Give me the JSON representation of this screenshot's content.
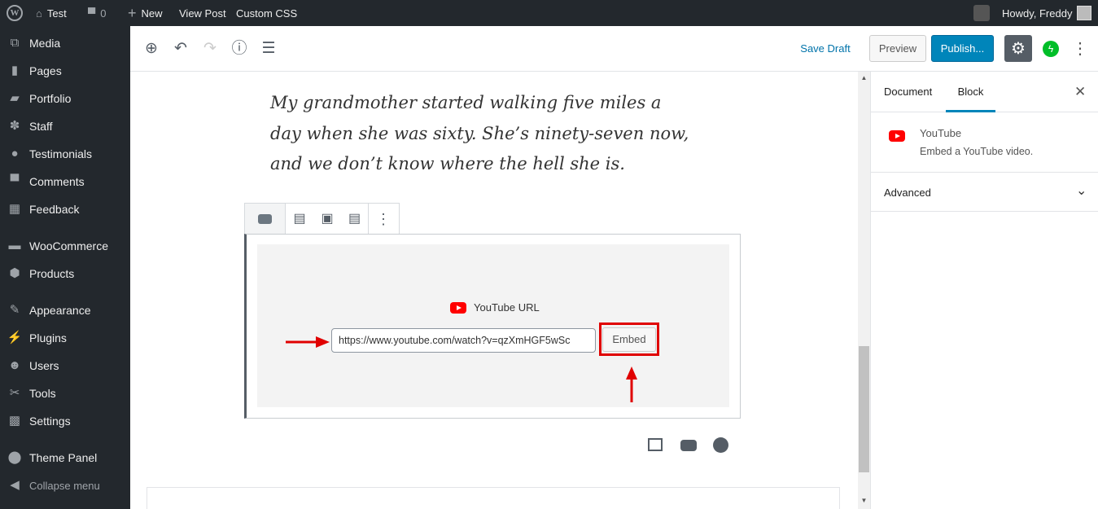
{
  "adminbar": {
    "site": "Test",
    "comments": "0",
    "new": "New",
    "view_post": "View Post",
    "custom_css": "Custom CSS",
    "howdy": "Howdy, Freddy"
  },
  "sidebar": {
    "items": [
      {
        "label": "Media",
        "icon": "media-icon"
      },
      {
        "label": "Pages",
        "icon": "pages-icon"
      },
      {
        "label": "Portfolio",
        "icon": "portfolio-icon"
      },
      {
        "label": "Staff",
        "icon": "staff-icon"
      },
      {
        "label": "Testimonials",
        "icon": "testimonials-icon"
      },
      {
        "label": "Comments",
        "icon": "comments-icon"
      },
      {
        "label": "Feedback",
        "icon": "feedback-icon"
      },
      {
        "label": "WooCommerce",
        "icon": "woocommerce-icon"
      },
      {
        "label": "Products",
        "icon": "products-icon"
      },
      {
        "label": "Appearance",
        "icon": "appearance-icon"
      },
      {
        "label": "Plugins",
        "icon": "plugins-icon"
      },
      {
        "label": "Users",
        "icon": "users-icon"
      },
      {
        "label": "Tools",
        "icon": "tools-icon"
      },
      {
        "label": "Settings",
        "icon": "settings-icon"
      },
      {
        "label": "Theme Panel",
        "icon": "theme-panel-icon"
      },
      {
        "label": "Collapse menu",
        "icon": "collapse-icon"
      }
    ]
  },
  "header": {
    "save_draft": "Save Draft",
    "preview": "Preview",
    "publish": "Publish..."
  },
  "content": {
    "quote_lines": [
      "My grandmother started walking five miles a",
      "day when she was sixty. She’s ninety-seven now,",
      "and we don’t know where the hell she is."
    ],
    "embed": {
      "label": "YouTube URL",
      "url": "https://www.youtube.com/watch?v=qzXmHGF5wSc",
      "button": "Embed"
    }
  },
  "panel": {
    "tabs": [
      "Document",
      "Block"
    ],
    "active_tab": "Block",
    "block_name": "YouTube",
    "block_desc": "Embed a YouTube video.",
    "advanced": "Advanced"
  },
  "colors": {
    "accent": "#0085ba",
    "youtube": "#ff0000",
    "annotation": "#e00000",
    "adminbar": "#23282d"
  }
}
